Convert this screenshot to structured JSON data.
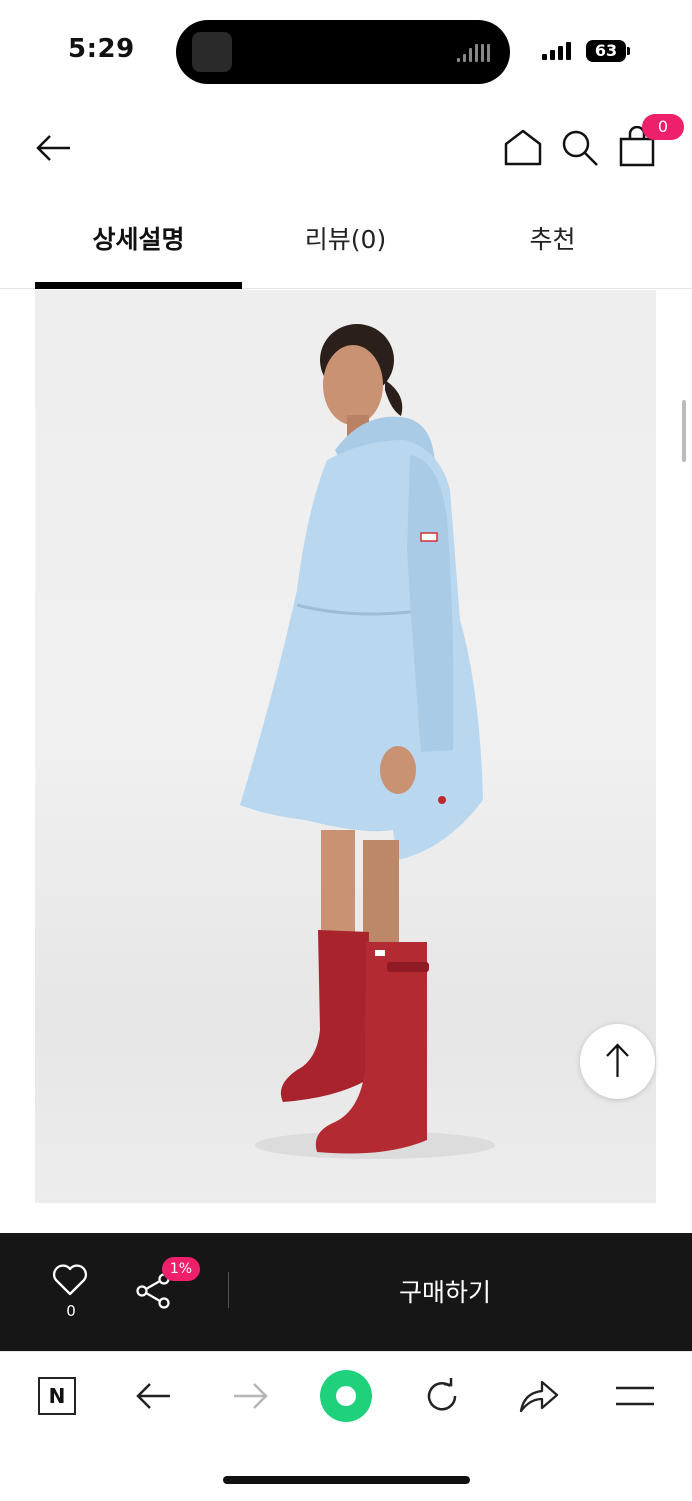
{
  "status_bar": {
    "time": "5:29",
    "battery": "63"
  },
  "header": {
    "back_icon": "arrow-left-icon",
    "home_icon": "home-icon",
    "search_icon": "search-icon",
    "cart_icon": "shopping-bag-icon",
    "cart_count": "0"
  },
  "tabs": [
    {
      "label": "상세설명",
      "active": true
    },
    {
      "label": "리뷰(0)",
      "active": false
    },
    {
      "label": "추천",
      "active": false
    }
  ],
  "product_image": {
    "description_icon": "product-photo"
  },
  "scroll_top_icon": "arrow-up-icon",
  "purchase_bar": {
    "wish_count": "0",
    "share_badge": "1%",
    "buy_label": "구매하기"
  },
  "browser_toolbar": {
    "logo_letter": "N",
    "items": [
      "naver-logo-icon",
      "back-icon",
      "forward-icon",
      "green-dot-icon",
      "reload-icon",
      "share-icon",
      "menu-icon"
    ]
  },
  "colors": {
    "accent_pink": "#ee1f6b",
    "bar_dark": "#161616",
    "green": "#1ed17a",
    "coat_blue": "#b9d7ef",
    "boot_red": "#a8232c"
  }
}
